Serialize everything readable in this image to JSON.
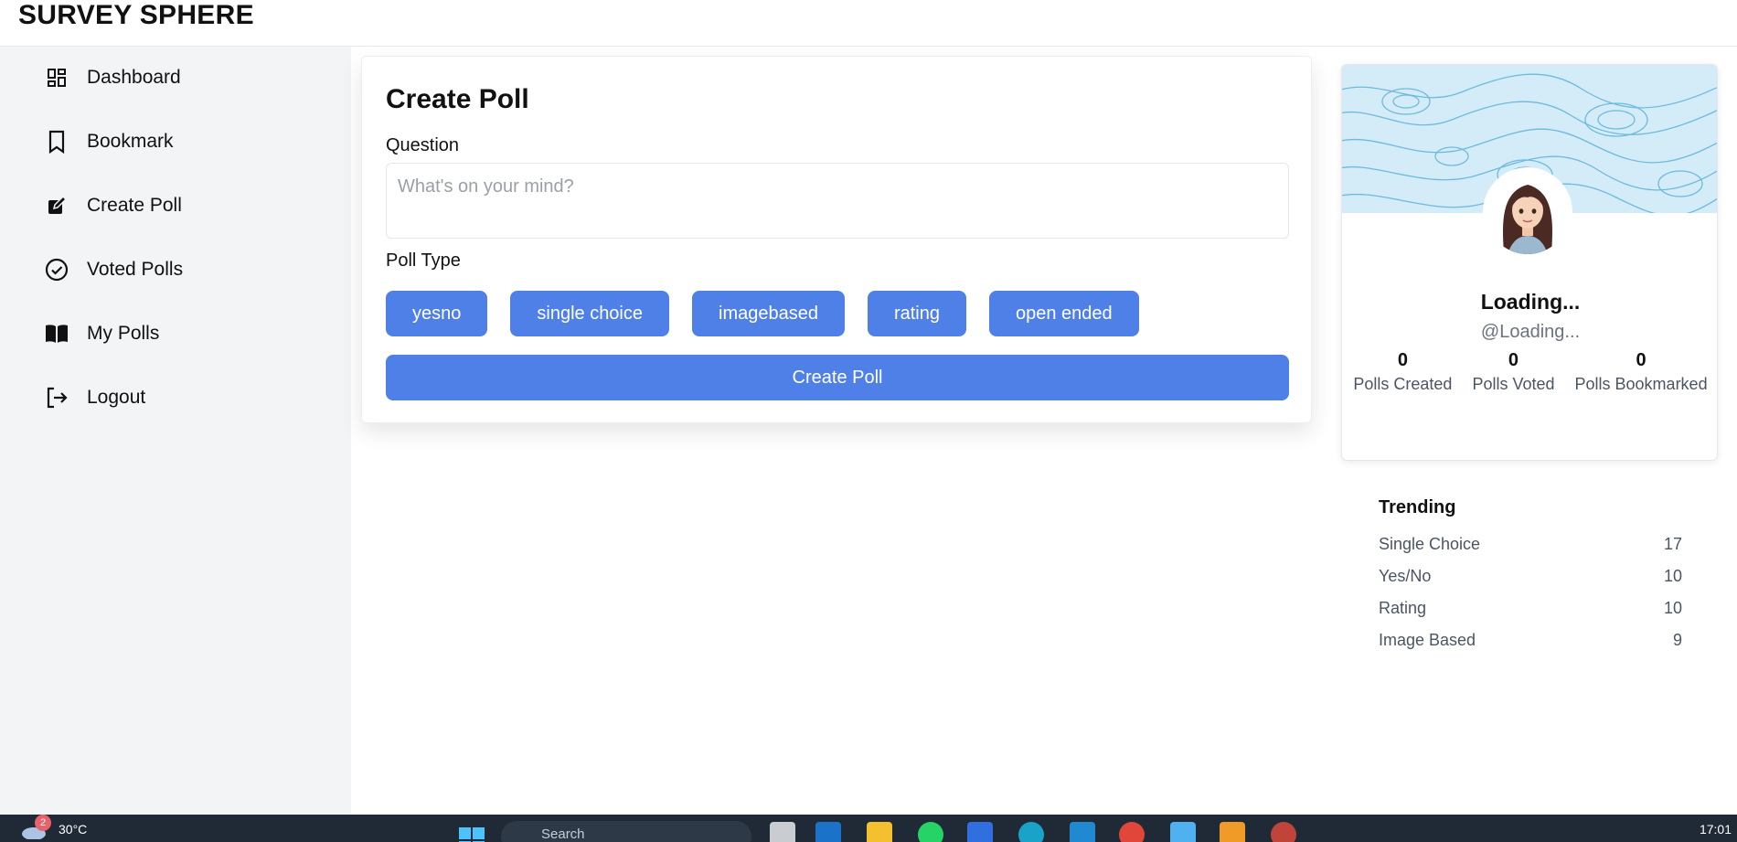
{
  "header": {
    "brand": "SURVEY SPHERE"
  },
  "sidebar": {
    "items": [
      {
        "label": "Dashboard",
        "icon": "dashboard-icon"
      },
      {
        "label": "Bookmark",
        "icon": "bookmark-icon"
      },
      {
        "label": "Create Poll",
        "icon": "edit-icon"
      },
      {
        "label": "Voted Polls",
        "icon": "check-circle-icon"
      },
      {
        "label": "My Polls",
        "icon": "book-icon"
      },
      {
        "label": "Logout",
        "icon": "logout-icon"
      }
    ]
  },
  "create_poll": {
    "title": "Create Poll",
    "question_label": "Question",
    "question_placeholder": "What's on your mind?",
    "question_value": "",
    "poll_type_label": "Poll Type",
    "poll_types": [
      "yesno",
      "single choice",
      "imagebased",
      "rating",
      "open ended"
    ],
    "submit_label": "Create Poll",
    "accent_color": "#4f80e8"
  },
  "profile": {
    "name": "Loading...",
    "handle": "@Loading...",
    "stats": [
      {
        "value": "0",
        "label": "Polls Created"
      },
      {
        "value": "0",
        "label": "Polls Voted"
      },
      {
        "value": "0",
        "label": "Polls Bookmarked"
      }
    ]
  },
  "trending": {
    "title": "Trending",
    "items": [
      {
        "label": "Single Choice",
        "count": "17"
      },
      {
        "label": "Yes/No",
        "count": "10"
      },
      {
        "label": "Rating",
        "count": "10"
      },
      {
        "label": "Image Based",
        "count": "9"
      }
    ]
  },
  "taskbar": {
    "weather_badge": "2",
    "temperature": "30°C",
    "search_placeholder": "Search",
    "time": "17:01"
  }
}
